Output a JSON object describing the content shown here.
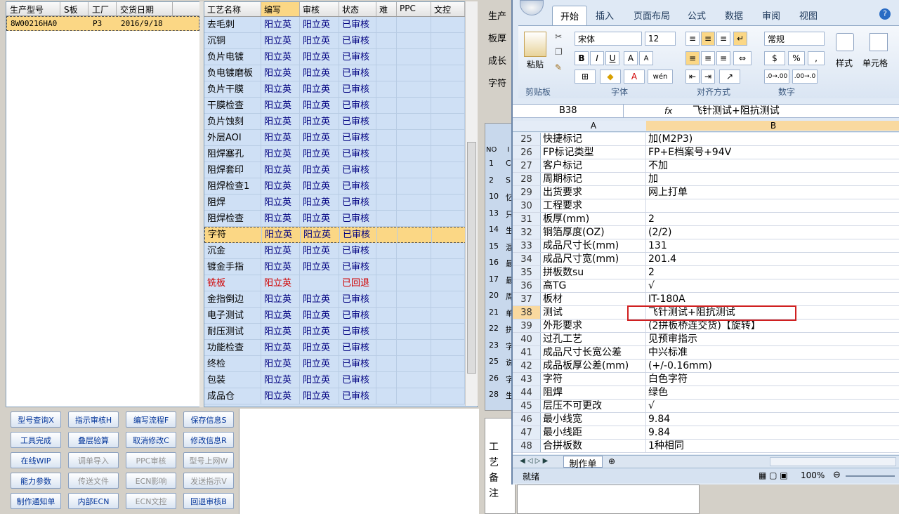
{
  "orders": {
    "headers": [
      "生产型号",
      "S板",
      "工厂",
      "交货日期"
    ],
    "row": [
      "8W00216HA0",
      "",
      "P3",
      "2016/9/18"
    ]
  },
  "procs": {
    "headers": [
      "工艺名称",
      "编写",
      "审核",
      "状态",
      "难",
      "PPC",
      "文控"
    ],
    "rows": [
      [
        "去毛刺",
        "阳立英",
        "阳立英",
        "已审核"
      ],
      [
        "沉铜",
        "阳立英",
        "阳立英",
        "已审核"
      ],
      [
        "负片电镀",
        "阳立英",
        "阳立英",
        "已审核"
      ],
      [
        "负电镀磨板",
        "阳立英",
        "阳立英",
        "已审核"
      ],
      [
        "负片干膜",
        "阳立英",
        "阳立英",
        "已审核"
      ],
      [
        "干膜检查",
        "阳立英",
        "阳立英",
        "已审核"
      ],
      [
        "负片蚀刻",
        "阳立英",
        "阳立英",
        "已审核"
      ],
      [
        "外层AOI",
        "阳立英",
        "阳立英",
        "已审核"
      ],
      [
        "阻焊塞孔",
        "阳立英",
        "阳立英",
        "已审核"
      ],
      [
        "阻焊套印",
        "阳立英",
        "阳立英",
        "已审核"
      ],
      [
        "阻焊检查1",
        "阳立英",
        "阳立英",
        "已审核"
      ],
      [
        "阻焊",
        "阳立英",
        "阳立英",
        "已审核"
      ],
      [
        "阻焊检查",
        "阳立英",
        "阳立英",
        "已审核"
      ],
      [
        "字符",
        "阳立英",
        "阳立英",
        "已审核"
      ],
      [
        "沉金",
        "阳立英",
        "阳立英",
        "已审核"
      ],
      [
        "镀金手指",
        "阳立英",
        "阳立英",
        "已审核"
      ],
      [
        "铣板",
        "阳立英",
        "",
        "已回退"
      ],
      [
        "金指倒边",
        "阳立英",
        "阳立英",
        "已审核"
      ],
      [
        "电子测试",
        "阳立英",
        "阳立英",
        "已审核"
      ],
      [
        "耐压测试",
        "阳立英",
        "阳立英",
        "已审核"
      ],
      [
        "功能检查",
        "阳立英",
        "阳立英",
        "已审核"
      ],
      [
        "终检",
        "阳立英",
        "阳立英",
        "已审核"
      ],
      [
        "包装",
        "阳立英",
        "阳立英",
        "已审核"
      ],
      [
        "成品仓",
        "阳立英",
        "阳立英",
        "已审核"
      ]
    ],
    "selected_index": 13,
    "red_index": 16
  },
  "buttons": [
    [
      "型号查询X",
      "指示审核H",
      "编写流程F",
      "保存信息S"
    ],
    [
      "工具完成",
      "叠层验算",
      "取消修改C",
      "修改信息R"
    ],
    [
      "在线WIP",
      "调单导入",
      "PPC审核",
      "型号上网W"
    ],
    [
      "能力参数",
      "传送文件",
      "ECN影响",
      "发送指示V"
    ],
    [
      "制作通知单",
      "内部ECN",
      "ECN文控",
      "回退审核B"
    ]
  ],
  "disabled_buttons": [
    "调单导入",
    "PPC审核",
    "型号上网W",
    "传送文件",
    "ECN影响",
    "发送指示V",
    "ECN文控"
  ],
  "mid": {
    "labels": [
      "生产",
      "板厚",
      "成长",
      "字符"
    ],
    "hdr": [
      "NO",
      "I"
    ],
    "rows": [
      [
        "1",
        "C"
      ],
      [
        "2",
        "S"
      ],
      [
        "10",
        "忆"
      ],
      [
        "13",
        "只"
      ],
      [
        "14",
        "生"
      ],
      [
        "15",
        "混"
      ],
      [
        "16",
        "最"
      ],
      [
        "17",
        "最"
      ],
      [
        "20",
        "周"
      ],
      [
        "21",
        "单"
      ],
      [
        "22",
        "拼"
      ],
      [
        "23",
        "字"
      ],
      [
        "25",
        "说"
      ],
      [
        "26",
        "字"
      ],
      [
        "28",
        "生"
      ]
    ],
    "bottom": [
      "工",
      "艺",
      "备",
      "注"
    ],
    "bottom2": "注"
  },
  "excel": {
    "tabs": [
      "开始",
      "插入",
      "页面布局",
      "公式",
      "数据",
      "审阅",
      "视图"
    ],
    "font_name": "宋体",
    "font_size": "12",
    "number_format": "常规",
    "groups": [
      "剪贴板",
      "字体",
      "对齐方式",
      "数字"
    ],
    "group_btns": {
      "paste": "粘贴",
      "style": "样式",
      "cells": "单元格"
    },
    "namebox": "B38",
    "fx": "fx",
    "formula": "飞针测试+阻抗测试",
    "col_a": "A",
    "col_b": "B",
    "rows": [
      [
        "25",
        "快捷标记",
        "加(M2P3)"
      ],
      [
        "26",
        "FP标记类型",
        "FP+E档案号+94V"
      ],
      [
        "27",
        "客户标记",
        "不加"
      ],
      [
        "28",
        "周期标记",
        "加"
      ],
      [
        "29",
        "出货要求",
        "网上打单"
      ],
      [
        "30",
        "工程要求",
        ""
      ],
      [
        "31",
        "板厚(mm)",
        "2"
      ],
      [
        "32",
        "铜箔厚度(OZ)",
        "(2/2)"
      ],
      [
        "33",
        "成品尺寸长(mm)",
        "131"
      ],
      [
        "34",
        "成品尺寸宽(mm)",
        "201.4"
      ],
      [
        "35",
        "拼板数su",
        "2"
      ],
      [
        "36",
        "高TG",
        "√"
      ],
      [
        "37",
        "板材",
        "IT-180A"
      ],
      [
        "38",
        "测试",
        "飞针测试+阻抗测试"
      ],
      [
        "39",
        "外形要求",
        "(2拼板桥连交货)【旋转】"
      ],
      [
        "40",
        "过孔工艺",
        "见预审指示"
      ],
      [
        "41",
        "成品尺寸长宽公差",
        "中兴标准"
      ],
      [
        "42",
        "成品板厚公差(mm)",
        "(+/-0.16mm)"
      ],
      [
        "43",
        "字符",
        "白色字符"
      ],
      [
        "44",
        "阻焊",
        "绿色"
      ],
      [
        "45",
        "层压不可更改",
        "√"
      ],
      [
        "46",
        "最小线宽",
        "9.84"
      ],
      [
        "47",
        "最小线距",
        "9.84"
      ],
      [
        "48",
        "合拼板数",
        "1种相同"
      ]
    ],
    "selected_row": "38",
    "sheet_tab": "制作单",
    "status": "就绪",
    "zoom": "100%"
  }
}
